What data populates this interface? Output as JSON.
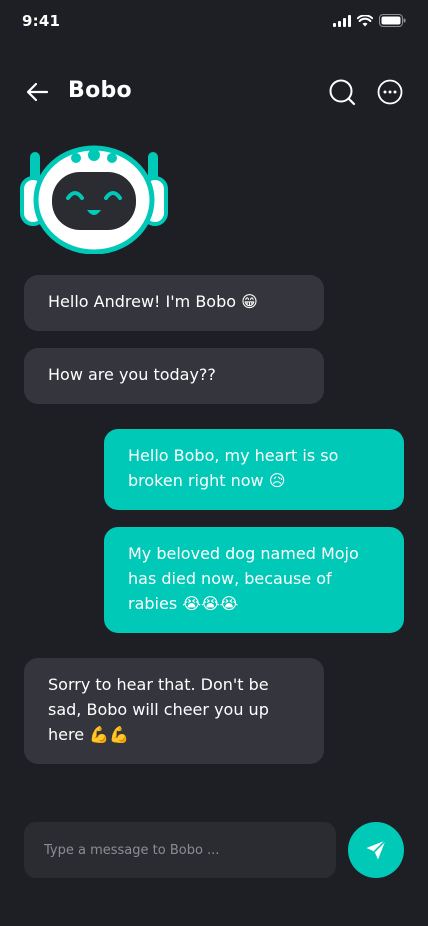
{
  "status_bar": {
    "time": "9:41"
  },
  "header": {
    "title": "Bobo"
  },
  "messages": [
    {
      "from": "bot",
      "text": "Hello Andrew! I'm Bobo 😁"
    },
    {
      "from": "bot",
      "text": "How are you today??"
    },
    {
      "from": "user",
      "text": "Hello Bobo, my heart is so broken right now 😥"
    },
    {
      "from": "user",
      "text": "My beloved dog named Mojo has died now, because of rabies 😭😭😭"
    },
    {
      "from": "bot",
      "text": "Sorry to hear that. Don't be sad, Bobo will cheer you up here 💪💪"
    }
  ],
  "composer": {
    "placeholder": "Type a message to Bobo ..."
  },
  "colors": {
    "background": "#1e1f24",
    "bot_bubble": "#35363d",
    "accent": "#00c9b8"
  },
  "icons": [
    "back-arrow-icon",
    "search-icon",
    "more-options-icon",
    "robot-avatar-icon",
    "send-icon",
    "signal-icon",
    "wifi-icon",
    "battery-icon"
  ]
}
